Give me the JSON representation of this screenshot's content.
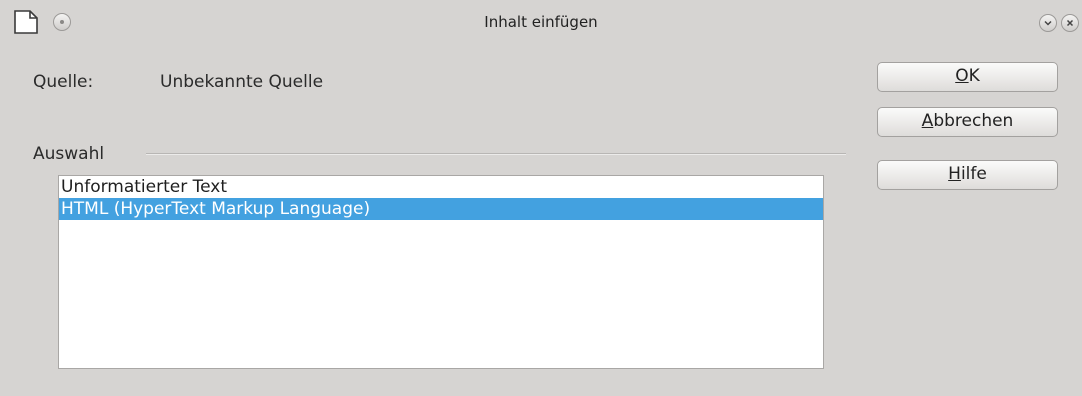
{
  "window": {
    "title": "Inhalt einfügen"
  },
  "source": {
    "label": "Quelle:",
    "value": "Unbekannte Quelle"
  },
  "selection": {
    "label": "Auswahl",
    "items": [
      {
        "label": "Unformatierter Text",
        "selected": false
      },
      {
        "label": "HTML (HyperText Markup Language)",
        "selected": true
      }
    ]
  },
  "buttons": {
    "ok": {
      "mnemonic": "O",
      "rest": "K"
    },
    "cancel": {
      "mnemonic": "A",
      "rest": "bbrechen"
    },
    "help": {
      "mnemonic": "H",
      "rest": "ilfe"
    }
  },
  "colors": {
    "selection": "#43a1e0",
    "background": "#d6d4d2"
  },
  "icons": [
    "document-icon",
    "window-menu-icon",
    "minimize-icon",
    "close-icon"
  ]
}
